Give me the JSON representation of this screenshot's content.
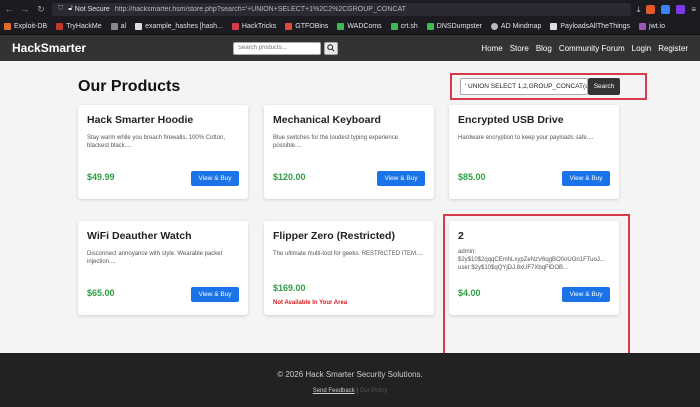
{
  "browser": {
    "not_secure": "Not Secure",
    "url": "http://hacksmarter.hsm/store.php?search='+UNION+SELECT+1%2C2%2CGROUP_CONCAT",
    "bookmarks": [
      {
        "label": "Exploit-DB",
        "color": "#e06c2b"
      },
      {
        "label": "TryHackMe",
        "color": "#c0392b"
      },
      {
        "label": "al",
        "color": "#888888"
      },
      {
        "label": "example_hashes [hash...",
        "color": "#dddddd"
      },
      {
        "label": "HackTricks",
        "color": "#d63a4b"
      },
      {
        "label": "GTFOBins",
        "color": "#e04a3f"
      },
      {
        "label": "WADComs",
        "color": "#3fb950"
      },
      {
        "label": "crt.sh",
        "color": "#3fb950"
      },
      {
        "label": "DNSDumpster",
        "color": "#3fb950"
      },
      {
        "label": "AD Mindmap",
        "color": "#bbbbbb"
      },
      {
        "label": "PayloadsAllTheThings",
        "color": "#dddddd"
      },
      {
        "label": "jwt.io",
        "color": "#9b59b6"
      }
    ]
  },
  "site": {
    "brand": "HackSmarter",
    "search_placeholder": "Search products...",
    "nav_links": [
      "Home",
      "Store",
      "Blog",
      "Community Forum",
      "Login",
      "Register"
    ],
    "page_title": "Our Products",
    "search_value": "' UNION SELECT 1,2,GROUP_CONCAT(use",
    "search_button": "Search"
  },
  "products": [
    {
      "title": "Hack Smarter Hoodie",
      "desc": "Stay warm while you breach firewalls. 100% Cotton, blackest black....",
      "price": "$49.99",
      "button": "View & Buy"
    },
    {
      "title": "Mechanical Keyboard",
      "desc": "Blue switches for the loudest typing experience possible....",
      "price": "$120.00",
      "button": "View & Buy"
    },
    {
      "title": "Encrypted USB Drive",
      "desc": "Hardware encryption to keep your payloads safe....",
      "price": "$85.00",
      "button": "View & Buy"
    },
    {
      "title": "WiFi Deauther Watch",
      "desc": "Disconnect annoyance with style. Wearable packet injection....",
      "price": "$65.00",
      "button": "View & Buy"
    },
    {
      "title": "Flipper Zero (Restricted)",
      "desc": "The ultimate multi-tool for geeks. RESTRICTED ITEM....",
      "price": "$169.00",
      "restricted": "Not Available In Your Area"
    },
    {
      "title": "2",
      "leak1": "admin:",
      "leak2": "$2y$10$2qqqCEmhLxypZeNzV6qgBO0oUGn1FTuoJ...",
      "leak3": "user:$2y$10$qQYjDJ.8xUF7XbqFlDOB...",
      "price": "$4.00",
      "button": "View & Buy"
    }
  ],
  "footer": {
    "copyright": "© 2026 Hack Smarter Security Solutions.",
    "feedback": "Send Feedback",
    "separator": "|",
    "other": "Our Policy"
  }
}
